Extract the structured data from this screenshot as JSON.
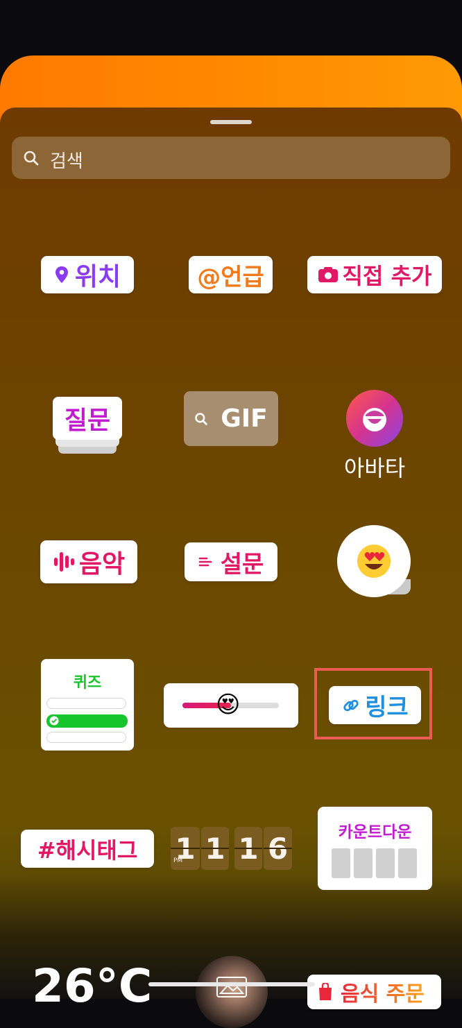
{
  "search": {
    "placeholder": "검색",
    "icon": "search-icon"
  },
  "stickers": {
    "location": "위치",
    "mention": "@언급",
    "add_yours": "직접 추가",
    "question": "질문",
    "gif": "GIF",
    "avatar": "아바타",
    "music": "음악",
    "poll": "설문",
    "emoji_slider": "😍",
    "quiz": "퀴즈",
    "link": "링크",
    "hashtag": "#해시태그",
    "countdown": "카운트다운",
    "clock": {
      "h1": "1",
      "h2": "1",
      "m1": "1",
      "m2": "6",
      "ampm": "PM"
    },
    "temperature": "26°C",
    "food_order": "음식 주문"
  },
  "colors": {
    "accent_purple": "#8a3cf0",
    "accent_orange": "#f27a1a",
    "accent_pink": "#e01866",
    "accent_blue": "#1f8fe0",
    "accent_green": "#17c42c",
    "highlight_red": "#ec5a54"
  }
}
